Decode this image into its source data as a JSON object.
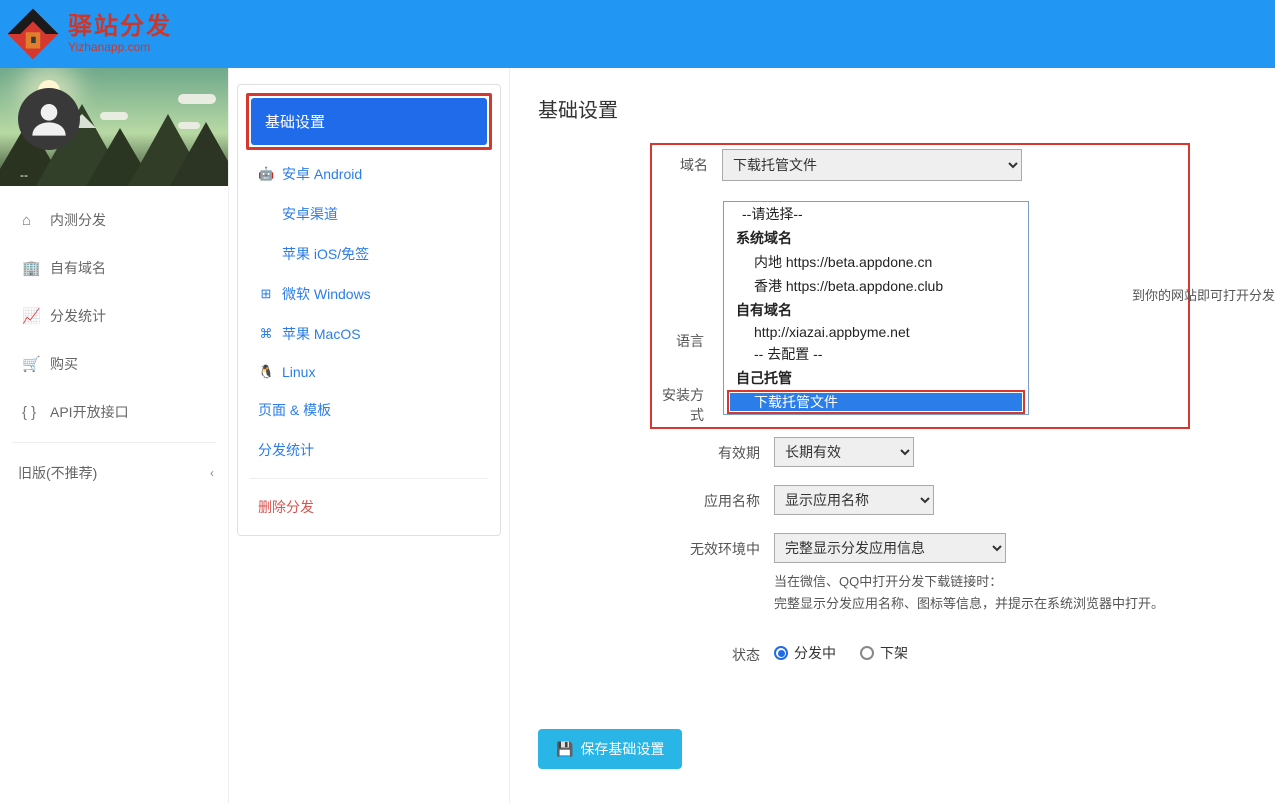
{
  "brand": {
    "cn": "驿站分发",
    "en": "Yizhanapp.com"
  },
  "user_dash": "--",
  "leftnav": {
    "items": [
      {
        "label": "内测分发"
      },
      {
        "label": "自有域名"
      },
      {
        "label": "分发统计"
      },
      {
        "label": "购买"
      },
      {
        "label": "API开放接口"
      }
    ],
    "group_label": "旧版(不推荐)"
  },
  "subnav": {
    "active": "基础设置",
    "android": "安卓 Android",
    "android_channel": "安卓渠道",
    "ios": "苹果 iOS/免签",
    "windows": "微软 Windows",
    "macos": "苹果 MacOS",
    "linux": "Linux",
    "page_tpl": "页面 & 模板",
    "stats": "分发统计",
    "delete": "删除分发"
  },
  "page": {
    "title": "基础设置",
    "labels": {
      "domain": "域名",
      "lang": "语言",
      "install": "安装方式",
      "validity": "有效期",
      "appname": "应用名称",
      "invalid_env": "无效环境中",
      "status": "状态"
    },
    "domain_selected": "下载托管文件",
    "domain_options": {
      "placeholder": "--请选择--",
      "grp_sys": "系统域名",
      "sys1": "内地 https://beta.appdone.cn",
      "sys2": "香港 https://beta.appdone.club",
      "grp_own": "自有域名",
      "own1": "http://xiazai.appbyme.net",
      "own2": "-- 去配置 --",
      "grp_self": "自己托管",
      "self1": "下载托管文件"
    },
    "side_note": "到你的网站即可打开分发链接。",
    "validity_val": "长期有效",
    "appname_val": "显示应用名称",
    "invalid_env_val": "完整显示分发应用信息",
    "env_hint1": "当在微信、QQ中打开分发下载链接时：",
    "env_hint2": "完整显示分发应用名称、图标等信息，并提示在系统浏览器中打开。",
    "status_opts": {
      "on": "分发中",
      "off": "下架"
    },
    "save_btn": "保存基础设置"
  }
}
